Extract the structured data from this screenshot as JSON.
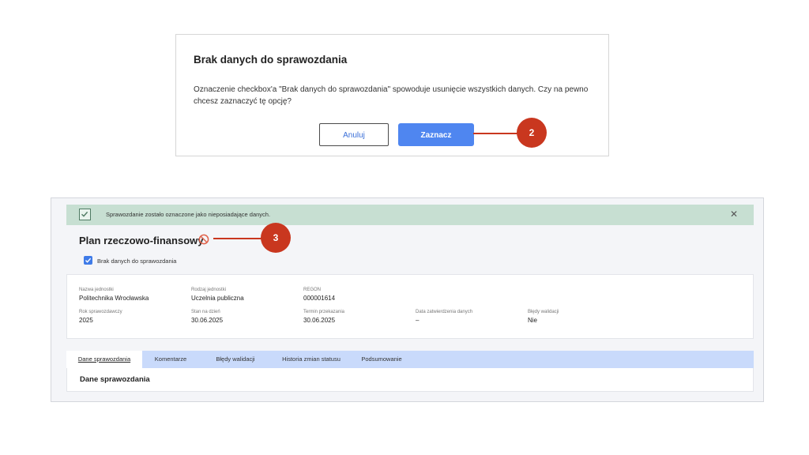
{
  "dialog": {
    "title": "Brak danych do sprawozdania",
    "message": "Oznaczenie checkbox'a \"Brak danych do sprawozdania\" spowoduje usunięcie wszystkich danych. Czy na pewno chcesz zaznaczyć tę opcję?",
    "cancel_label": "Anuluj",
    "confirm_label": "Zaznacz"
  },
  "callouts": {
    "step_2": "2",
    "step_3": "3",
    "color": "#c9371f"
  },
  "banner": {
    "message": "Sprawozdanie zostało oznaczone jako nieposiadające danych.",
    "icon": "check-square-icon",
    "close_icon": "close-icon",
    "close_glyph": "✕",
    "color": "#c7dfd2"
  },
  "page": {
    "title": "Plan rzeczowo-finansowy",
    "status_icon": "ban-icon",
    "no_data_checkbox": {
      "label": "Brak danych do sprawozdania",
      "checked": true
    }
  },
  "info": {
    "fields": [
      {
        "label": "Nazwa jednostki",
        "value": "Politechnika Wrocławska"
      },
      {
        "label": "Rodzaj jednostki",
        "value": "Uczelnia publiczna"
      },
      {
        "label": "REGON",
        "value": "000001614"
      },
      {
        "label": "Rok sprawozdawczy",
        "value": "2025"
      },
      {
        "label": "Stan na dzień",
        "value": "30.06.2025"
      },
      {
        "label": "Termin przekazania",
        "value": "30.06.2025"
      },
      {
        "label": "Data zatwierdzenia danych",
        "value": "–"
      },
      {
        "label": "Błędy walidacji",
        "value": "Nie"
      }
    ]
  },
  "tabs": [
    {
      "label": "Dane sprawozdania",
      "active": true
    },
    {
      "label": "Komentarze",
      "active": false
    },
    {
      "label": "Błędy walidacji",
      "active": false
    },
    {
      "label": "Historia zmian statusu",
      "active": false
    },
    {
      "label": "Podsumowanie",
      "active": false
    }
  ],
  "content": {
    "section_title": "Dane sprawozdania"
  },
  "colors": {
    "primary": "#4f86f0",
    "tabs_bar": "#c9dafb",
    "ban_icon": "#e0624a"
  }
}
